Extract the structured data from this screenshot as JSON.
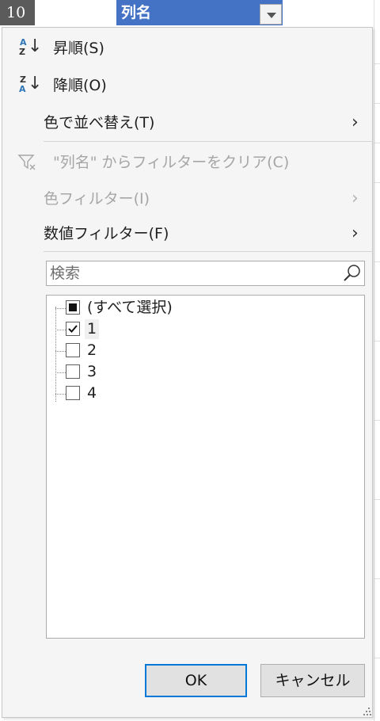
{
  "sheet": {
    "row_header": "10",
    "column_header": "列名"
  },
  "menu": {
    "sort_asc": "昇順(S)",
    "sort_desc": "降順(O)",
    "sort_by_color": "色で並べ替え(T)",
    "clear_filter": "\"列名\" からフィルターをクリア(C)",
    "color_filter": "色フィルター(I)",
    "number_filter": "数値フィルター(F)"
  },
  "search": {
    "placeholder": "検索"
  },
  "values_list": [
    {
      "label": "(すべて選択)",
      "state": "indeterminate"
    },
    {
      "label": "1",
      "state": "checked"
    },
    {
      "label": "2",
      "state": "unchecked"
    },
    {
      "label": "3",
      "state": "unchecked"
    },
    {
      "label": "4",
      "state": "unchecked"
    }
  ],
  "buttons": {
    "ok": "OK",
    "cancel": "キャンセル"
  },
  "icons": {
    "sort_asc": "sort-ascending-icon",
    "sort_desc": "sort-descending-icon",
    "clear_filter": "clear-filter-icon",
    "submenu": "chevron-right-icon",
    "search": "search-icon"
  },
  "colors": {
    "header_accent": "#4472c4",
    "ok_focus_border": "#0078d7",
    "disabled_text": "#a6a6a6"
  }
}
